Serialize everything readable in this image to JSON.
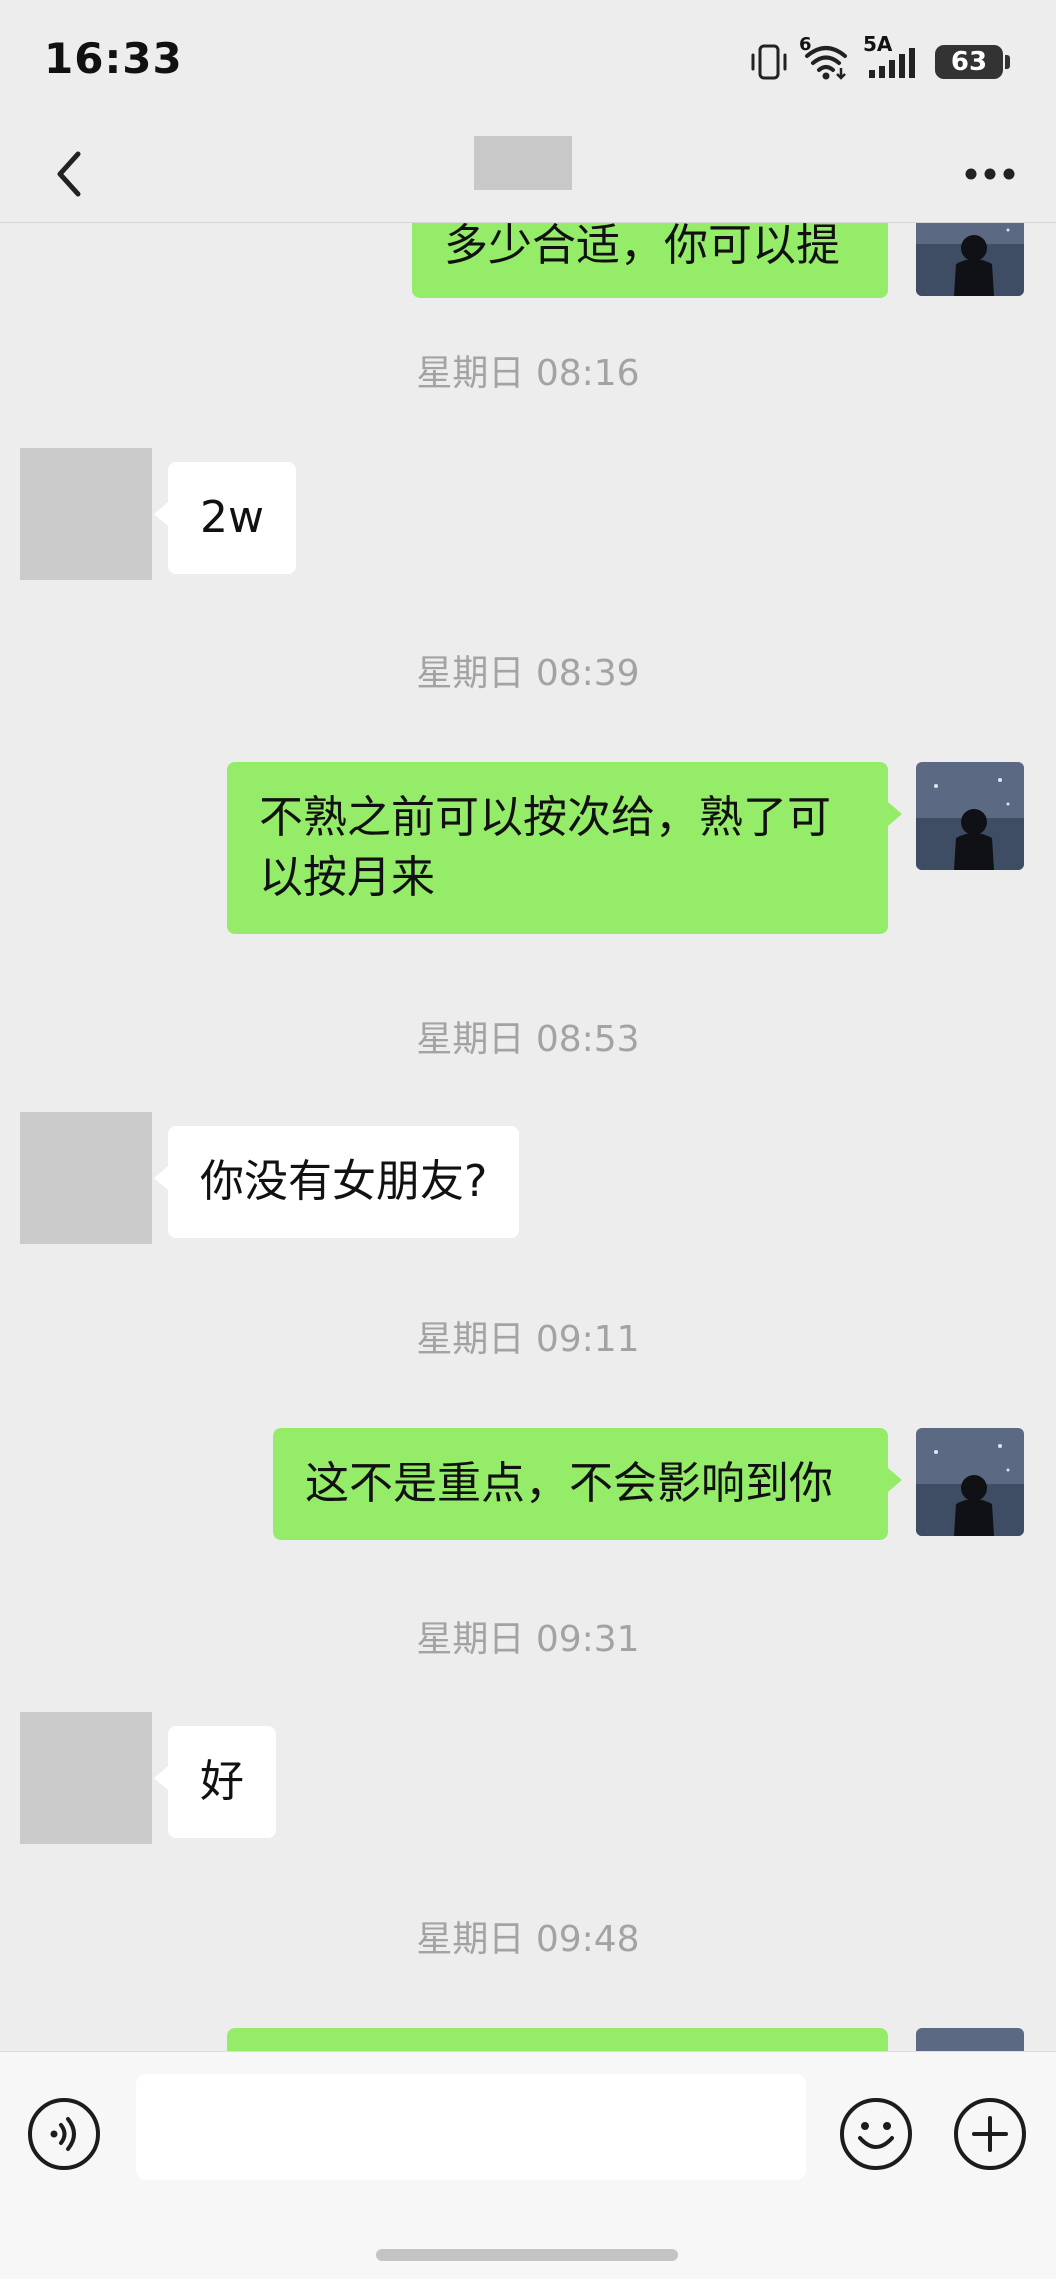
{
  "status_bar": {
    "time": "16:33",
    "network_label_small": "6",
    "network_type": "5A",
    "battery": "63"
  },
  "header": {
    "title": "",
    "back_icon": "chevron-left-icon",
    "more_icon": "more-dots-icon"
  },
  "messages": [
    {
      "type": "outgoing_text",
      "text": "多少合适，你可以提"
    },
    {
      "type": "timestamp",
      "text": "星期日 08:16"
    },
    {
      "type": "incoming_text",
      "text": "2w"
    },
    {
      "type": "timestamp",
      "text": "星期日 08:39"
    },
    {
      "type": "outgoing_text",
      "text": "不熟之前可以按次给，熟了可以按月来"
    },
    {
      "type": "timestamp",
      "text": "星期日 08:53"
    },
    {
      "type": "incoming_text",
      "text": "你没有女朋友?"
    },
    {
      "type": "timestamp",
      "text": "星期日 09:11"
    },
    {
      "type": "outgoing_text",
      "text": "这不是重点，不会影响到你"
    },
    {
      "type": "timestamp",
      "text": "星期日 09:31"
    },
    {
      "type": "incoming_text",
      "text": "好"
    },
    {
      "type": "timestamp",
      "text": "星期日 09:48"
    },
    {
      "type": "outgoing_text",
      "text": ""
    }
  ],
  "input_bar": {
    "value": "",
    "voice_icon": "voice-icon",
    "emoji_icon": "emoji-icon",
    "plus_icon": "plus-icon"
  },
  "colors": {
    "background": "#ededed",
    "outgoing_bubble": "#95ec69",
    "incoming_bubble": "#ffffff",
    "timestamp_text": "#a3a3a3"
  }
}
